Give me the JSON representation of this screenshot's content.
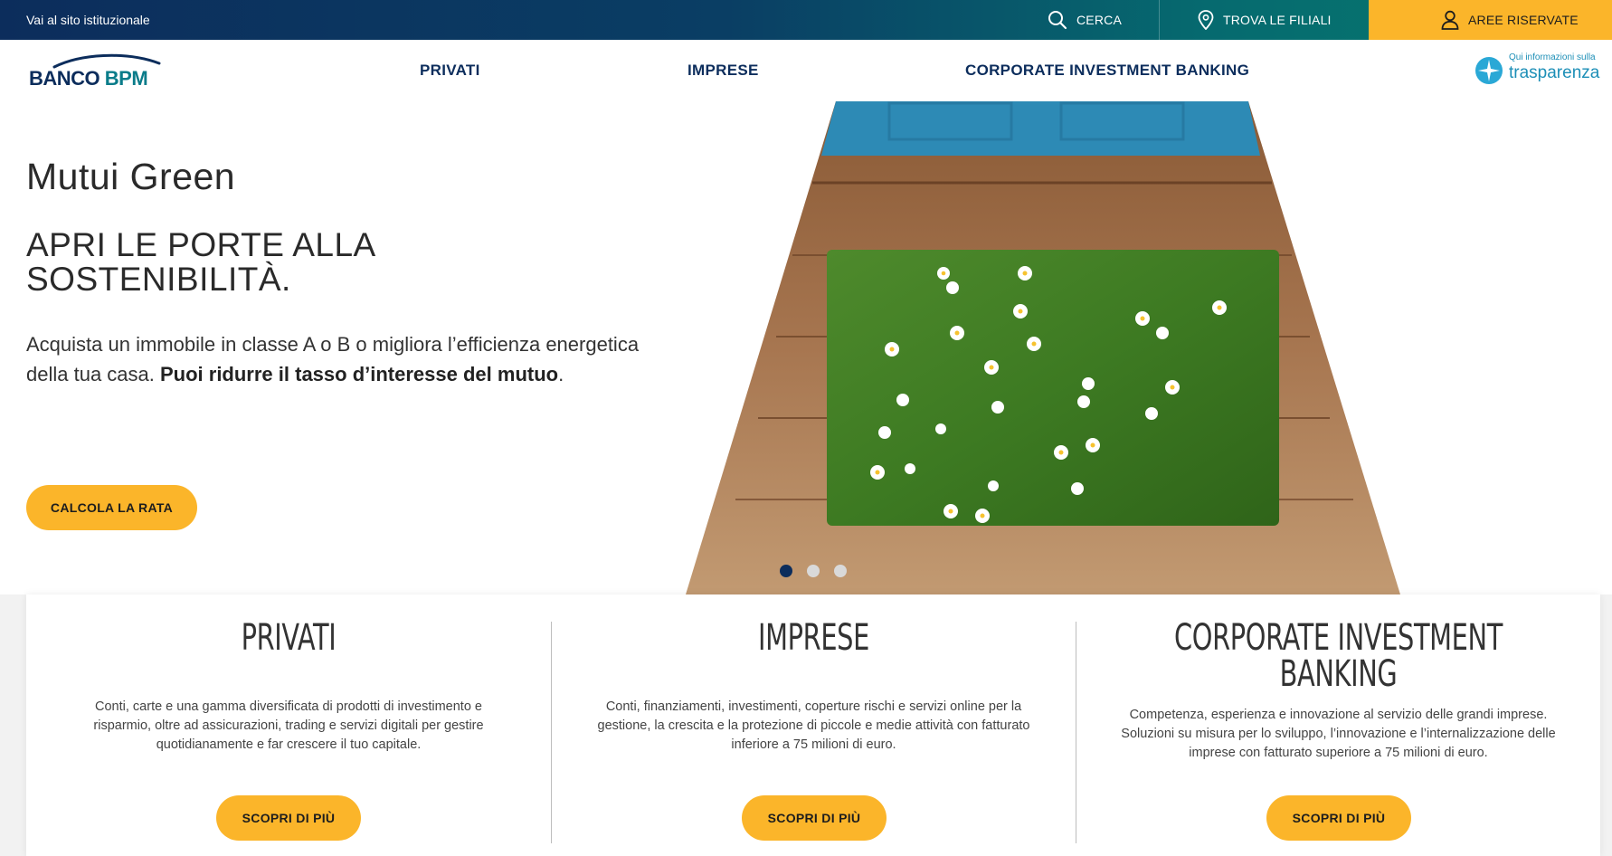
{
  "topbar": {
    "institutional_link": "Vai al sito istituzionale",
    "search_label": "CERCA",
    "branches_label": "TROVA LE FILIALI",
    "reserved_label": "AREE RISERVATE"
  },
  "header": {
    "logo_text_1": "BANCO",
    "logo_text_2": "BPM",
    "nav": [
      "PRIVATI",
      "IMPRESE",
      "CORPORATE INVESTMENT BANKING"
    ],
    "transparency_small": "Qui informazioni sulla",
    "transparency_big": "trasparenza"
  },
  "hero": {
    "title": "Mutui Green",
    "subtitle_line1": "APRI LE PORTE ALLA",
    "subtitle_line2": "SOSTENIBILITÀ.",
    "desc_plain": "Acquista un immobile in classe A o B o migliora l’efficienza energetica della tua casa. ",
    "desc_bold": "Puoi ridurre il tasso d’interesse del mutuo",
    "desc_end": ".",
    "cta": "CALCOLA LA RATA",
    "slides": 3,
    "active_slide": 1
  },
  "cards": [
    {
      "title": "PRIVATI",
      "text": "Conti, carte e una gamma diversificata di prodotti di investimento e risparmio, oltre ad assicurazioni, trading e servizi digitali per gestire quotidianamente e far crescere il tuo capitale.",
      "button": "SCOPRI DI PIÙ"
    },
    {
      "title": "IMPRESE",
      "text": "Conti, finanziamenti, investimenti, coperture rischi e servizi online per la gestione, la crescita e la protezione di piccole e medie attività con fatturato inferiore a 75 milioni di euro.",
      "button": "SCOPRI DI PIÙ"
    },
    {
      "title_line1": "CORPORATE INVESTMENT",
      "title_line2": "BANKING",
      "text_line1": "Competenza, esperienza e innovazione al servizio delle grandi imprese.",
      "text_line2": "Soluzioni su misura per lo sviluppo, l’innovazione e l’internalizzazione delle imprese con fatturato superiore a 75 milioni di euro.",
      "button": "SCOPRI DI PIÙ"
    }
  ],
  "colors": {
    "navy": "#0c2d5c",
    "teal": "#057a6e",
    "accent_yellow": "#fbb52a"
  }
}
